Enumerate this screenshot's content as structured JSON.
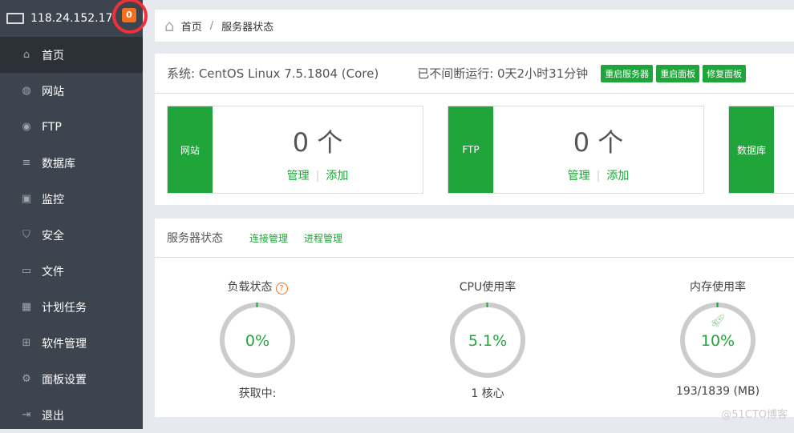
{
  "sidebar": {
    "ip": "118.24.152.17",
    "badge": "0",
    "items": [
      {
        "label": "首页",
        "icon": "home-icon",
        "glyph": "⌂"
      },
      {
        "label": "网站",
        "icon": "globe-icon",
        "glyph": "◍"
      },
      {
        "label": "FTP",
        "icon": "ftp-icon",
        "glyph": "◉"
      },
      {
        "label": "数据库",
        "icon": "database-icon",
        "glyph": "≡"
      },
      {
        "label": "监控",
        "icon": "monitor-icon",
        "glyph": "▣"
      },
      {
        "label": "安全",
        "icon": "shield-icon",
        "glyph": "⛉"
      },
      {
        "label": "文件",
        "icon": "folder-icon",
        "glyph": "▭"
      },
      {
        "label": "计划任务",
        "icon": "calendar-icon",
        "glyph": "▦"
      },
      {
        "label": "软件管理",
        "icon": "apps-icon",
        "glyph": "⊞"
      },
      {
        "label": "面板设置",
        "icon": "gear-icon",
        "glyph": "⚙"
      },
      {
        "label": "退出",
        "icon": "logout-icon",
        "glyph": "⇥"
      }
    ]
  },
  "breadcrumb": {
    "home": "首页",
    "sep": "/",
    "current": "服务器状态"
  },
  "system": {
    "os": "系统: CentOS Linux 7.5.1804 (Core)",
    "uptime": "已不间断运行: 0天2小时31分钟",
    "buttons": [
      "重启服务器",
      "重启面板",
      "修复面板"
    ],
    "tiles": [
      {
        "label": "网站",
        "count": "0 个",
        "manage": "管理",
        "add": "添加"
      },
      {
        "label": "FTP",
        "count": "0 个",
        "manage": "管理",
        "add": "添加"
      },
      {
        "label": "数据库"
      }
    ],
    "link_sep": "|"
  },
  "status": {
    "title": "服务器状态",
    "links": [
      "连接管理",
      "进程管理"
    ],
    "gauges": [
      {
        "title": "负载状态",
        "help": "?",
        "value": "0%",
        "percent": 0,
        "sub": "获取中:"
      },
      {
        "title": "CPU使用率",
        "value": "5.1%",
        "percent": 5.1,
        "sub": "1 核心"
      },
      {
        "title": "内存使用率",
        "value": "10%",
        "percent": 10,
        "sub": "193/1839 (MB)",
        "icon": "rocket-icon"
      }
    ]
  },
  "watermark": "@51CTO博客",
  "colors": {
    "green": "#20a53a",
    "sidebar": "#3c444d",
    "badge": "#f37021"
  }
}
